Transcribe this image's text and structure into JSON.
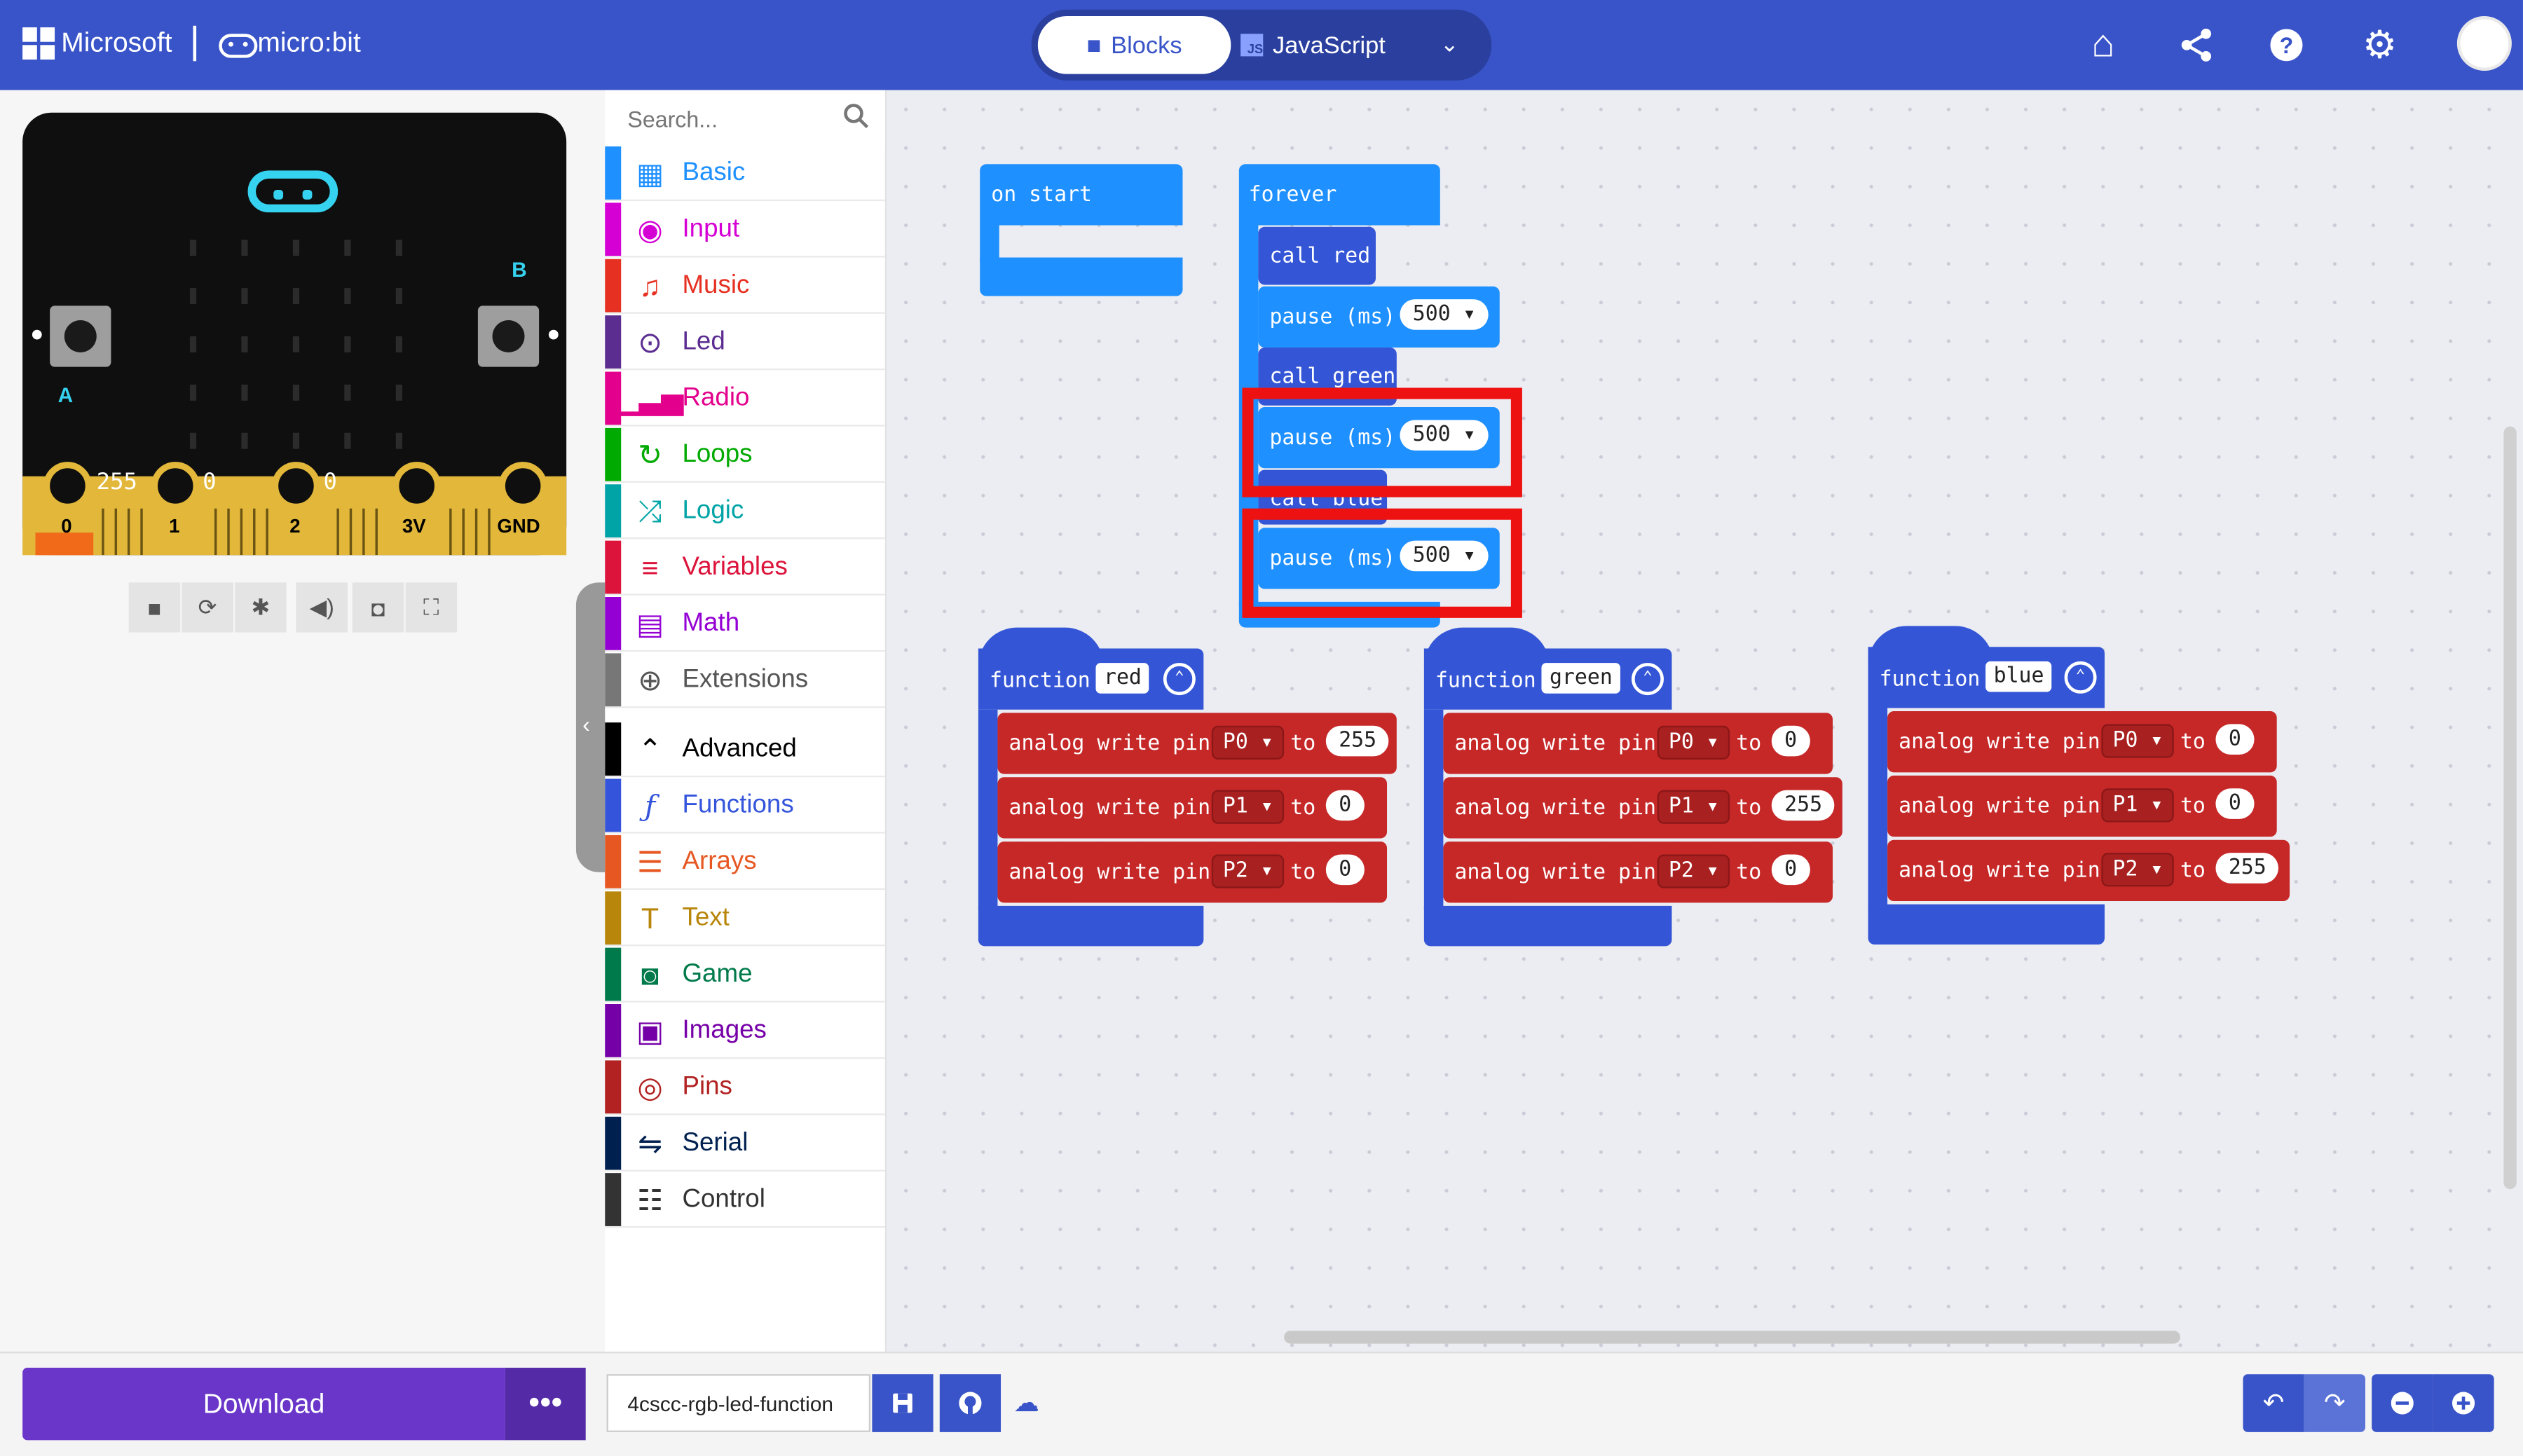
{
  "header": {
    "brand": "Microsoft",
    "product": "micro:bit",
    "tabs": [
      {
        "label": "Blocks"
      },
      {
        "label": "JavaScript"
      }
    ],
    "icons": [
      "home-icon",
      "share-icon",
      "help-icon",
      "settings-icon",
      "avatar"
    ]
  },
  "simulator": {
    "pins": [
      {
        "label": "0",
        "value": "255"
      },
      {
        "label": "1",
        "value": "0"
      },
      {
        "label": "2",
        "value": "0"
      },
      {
        "label": "3V"
      },
      {
        "label": "GND"
      }
    ],
    "buttons": {
      "a": "A",
      "b": "B"
    },
    "toolbar": [
      "stop-icon",
      "restart-icon",
      "debug-icon",
      "mute-icon",
      "screenshot-icon",
      "fullscreen-icon"
    ]
  },
  "toolbox": {
    "search_placeholder": "Search...",
    "categories": [
      {
        "label": "Basic",
        "color": "#1e90ff"
      },
      {
        "label": "Input",
        "color": "#d400d4"
      },
      {
        "label": "Music",
        "color": "#e63022"
      },
      {
        "label": "Led",
        "color": "#5c2d91"
      },
      {
        "label": "Radio",
        "color": "#e3008c"
      },
      {
        "label": "Loops",
        "color": "#00aa00"
      },
      {
        "label": "Logic",
        "color": "#00a4a6"
      },
      {
        "label": "Variables",
        "color": "#dc143c"
      },
      {
        "label": "Math",
        "color": "#9400d3"
      },
      {
        "label": "Extensions",
        "color": "#777777"
      },
      {
        "label": "Advanced",
        "color": "#000000"
      },
      {
        "label": "Functions",
        "color": "#3455db"
      },
      {
        "label": "Arrays",
        "color": "#e65722"
      },
      {
        "label": "Text",
        "color": "#b8860b"
      },
      {
        "label": "Game",
        "color": "#007a4b"
      },
      {
        "label": "Images",
        "color": "#7600a8"
      },
      {
        "label": "Pins",
        "color": "#b22222"
      },
      {
        "label": "Serial",
        "color": "#002050"
      },
      {
        "label": "Control",
        "color": "#333333"
      }
    ]
  },
  "workspace": {
    "on_start": {
      "label": "on start"
    },
    "forever": {
      "label": "forever",
      "statements": [
        {
          "text": "call red"
        },
        {
          "text": "pause (ms)",
          "value": "500"
        },
        {
          "text": "call green"
        },
        {
          "text": "pause (ms)",
          "value": "500"
        },
        {
          "text": "call blue"
        },
        {
          "text": "pause (ms)",
          "value": "500"
        }
      ]
    },
    "functions": [
      {
        "keyword": "function",
        "name": "red",
        "statements": [
          {
            "text": "analog write pin",
            "pin": "P0",
            "to": "to",
            "value": "255"
          },
          {
            "text": "analog write pin",
            "pin": "P1",
            "to": "to",
            "value": "0"
          },
          {
            "text": "analog write pin",
            "pin": "P2",
            "to": "to",
            "value": "0"
          }
        ]
      },
      {
        "keyword": "function",
        "name": "green",
        "statements": [
          {
            "text": "analog write pin",
            "pin": "P0",
            "to": "to",
            "value": "0"
          },
          {
            "text": "analog write pin",
            "pin": "P1",
            "to": "to",
            "value": "255"
          },
          {
            "text": "analog write pin",
            "pin": "P2",
            "to": "to",
            "value": "0"
          }
        ]
      },
      {
        "keyword": "function",
        "name": "blue",
        "statements": [
          {
            "text": "analog write pin",
            "pin": "P0",
            "to": "to",
            "value": "0"
          },
          {
            "text": "analog write pin",
            "pin": "P1",
            "to": "to",
            "value": "0"
          },
          {
            "text": "analog write pin",
            "pin": "P2",
            "to": "to",
            "value": "255"
          }
        ]
      }
    ],
    "highlight_color": "#ee1111"
  },
  "footer": {
    "download_label": "Download",
    "more_label": "•••",
    "project_name": "4cscc-rgb-led-function",
    "icons": [
      "save-icon",
      "github-icon",
      "cloud-icon",
      "undo-icon",
      "redo-icon",
      "zoom-out-icon",
      "zoom-in-icon"
    ]
  }
}
